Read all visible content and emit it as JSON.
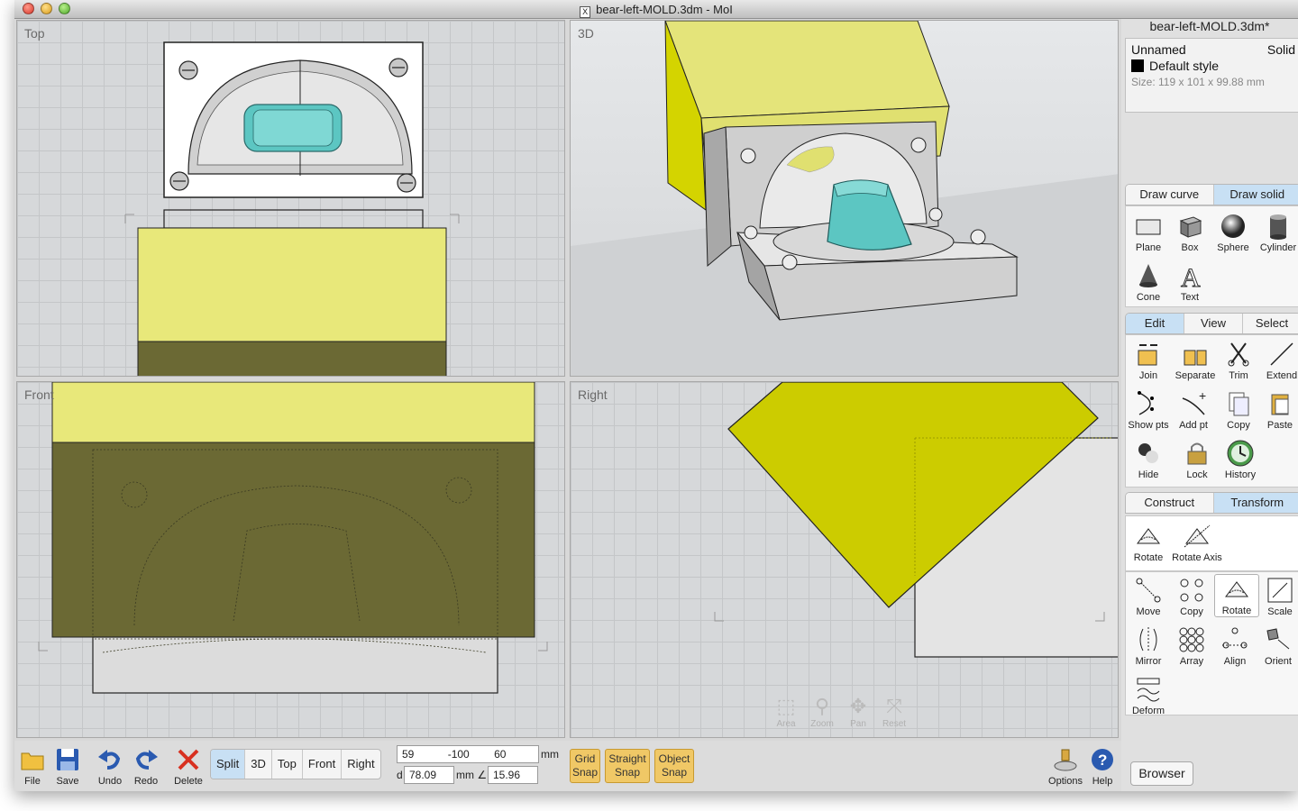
{
  "window": {
    "title": "bear-left-MOLD.3dm - MoI",
    "doc_icon": "X"
  },
  "viewports": {
    "top": {
      "label": "Top"
    },
    "three_d": {
      "label": "3D"
    },
    "front": {
      "label": "Front"
    },
    "right": {
      "label": "Right"
    }
  },
  "view_nav": [
    {
      "label": "Area",
      "icon": "area-icon"
    },
    {
      "label": "Zoom",
      "icon": "zoom-icon"
    },
    {
      "label": "Pan",
      "icon": "pan-icon"
    },
    {
      "label": "Reset",
      "icon": "reset-icon"
    }
  ],
  "panel": {
    "filename": "bear-left-MOLD.3dm*",
    "object_name": "Unnamed",
    "object_type": "Solid",
    "style": "Default style",
    "size": "Size: 119 x 101 x 99.88 mm",
    "draw_tabs": [
      "Draw curve",
      "Draw solid"
    ],
    "draw_tools": [
      "Plane",
      "Box",
      "Sphere",
      "Cylinder",
      "Cone",
      "Text"
    ],
    "edit_tabs": [
      "Edit",
      "View",
      "Select"
    ],
    "edit_tools": [
      "Join",
      "Separate",
      "Trim",
      "Extend",
      "Show pts",
      "Add pt",
      "Copy",
      "Paste",
      "Hide",
      "Lock",
      "History"
    ],
    "transform_tabs": [
      "Construct",
      "Transform"
    ],
    "rotate_tools": [
      "Rotate",
      "Rotate Axis"
    ],
    "transform_tools": [
      "Move",
      "Copy",
      "Rotate",
      "Scale",
      "Mirror",
      "Array",
      "Align",
      "Orient",
      "Deform"
    ]
  },
  "toolbar": {
    "file": "File",
    "save": "Save",
    "undo": "Undo",
    "redo": "Redo",
    "delete": "Delete",
    "views": [
      "Split",
      "3D",
      "Top",
      "Front",
      "Right"
    ],
    "active_view": "Split",
    "coord_x": "59",
    "coord_y": "-100",
    "coord_z": "60",
    "unit": "mm",
    "distance_label": "d",
    "distance": "78.09",
    "angle_label": "mm ∠",
    "angle": "15.96",
    "grid_snap": [
      "Grid",
      "Snap"
    ],
    "straight_snap": [
      "Straight",
      "Snap"
    ],
    "object_snap": [
      "Object",
      "Snap"
    ],
    "options": "Options",
    "help": "Help",
    "browser": "Browser"
  },
  "colors": {
    "yellow_solid": "#e8e87a",
    "dark_solid": "#6b6934",
    "teal": "#5cc6c2",
    "right_yellow": "#cccc00",
    "active_tab": "#c8e0f4"
  }
}
